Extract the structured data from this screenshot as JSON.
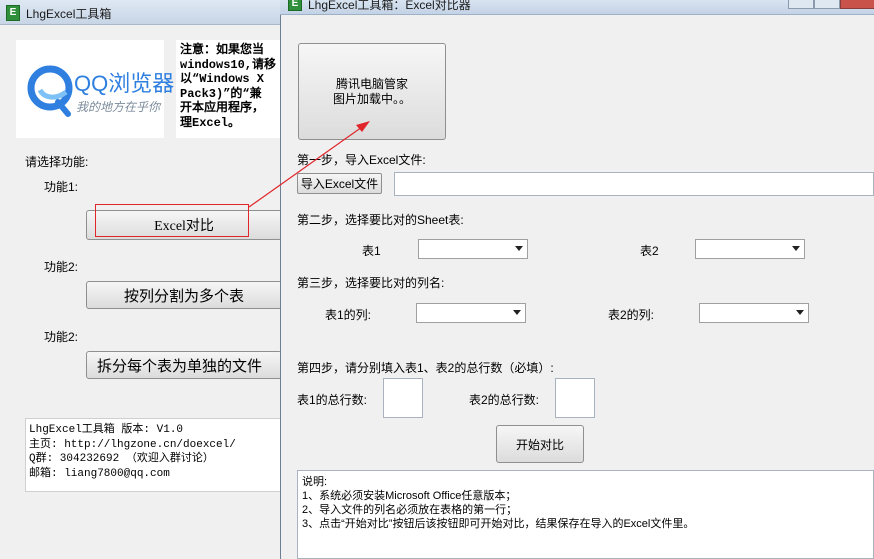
{
  "window1": {
    "title": "LhgExcel工具箱",
    "title_icon": "E",
    "ad_brand": "QQ浏览器",
    "ad_slogan": "我的地方在乎你",
    "notice_lines": [
      "注意：如果您当",
      "windows10,请移",
      "以“Windows X",
      "Pack3)”的“兼",
      "开本应用程序，",
      "理Excel。"
    ],
    "select_label": "请选择功能:",
    "feature1_label": "功能1:",
    "feature1_button": "Excel对比",
    "feature2_label": "功能2:",
    "feature2_button": "按列分割为多个表",
    "feature3_label": "功能2:",
    "feature3_button": "拆分每个表为单独的文件",
    "info_lines": [
      "LhgExcel工具箱 版本: V1.0",
      "主页: http://lhgzone.cn/doexcel/",
      "Q群: 304232692 （欢迎入群讨论）",
      "邮箱: liang7800@qq.com"
    ]
  },
  "window2": {
    "title": "LhgExcel工具箱：Excel对比器",
    "title_icon": "E",
    "image_placeholder_line1": "腾讯电脑管家",
    "image_placeholder_line2": "图片加载中。。",
    "step1_label": "第一步，导入Excel文件:",
    "import_button": "导入Excel文件",
    "file_path_value": "",
    "step2_label": "第二步，选择要比对的Sheet表:",
    "table1_label": "表1",
    "table2_label": "表2",
    "table1_sheet_value": "",
    "table2_sheet_value": "",
    "step3_label": "第三步，选择要比对的列名:",
    "table1_col_label": "表1的列:",
    "table2_col_label": "表2的列:",
    "table1_col_value": "",
    "table2_col_value": "",
    "step4_label": "第四步，请分别填入表1、表2的总行数（必填）:",
    "table1_rows_label": "表1的总行数:",
    "table2_rows_label": "表2的总行数:",
    "table1_rows_value": "",
    "table2_rows_value": "",
    "start_button": "开始对比",
    "notes_lines": [
      "说明:",
      "1、系统必须安装Microsoft Office任意版本；",
      "2、导入文件的列名必须放在表格的第一行；",
      "3、点击“开始对比”按钮后该按钮即可开始对比，结果保存在导入的Excel文件里。"
    ]
  },
  "colors": {
    "arrow": "#e0262b",
    "highlight_box": "#e0262b",
    "qq_blue": "#2e7fe0"
  }
}
